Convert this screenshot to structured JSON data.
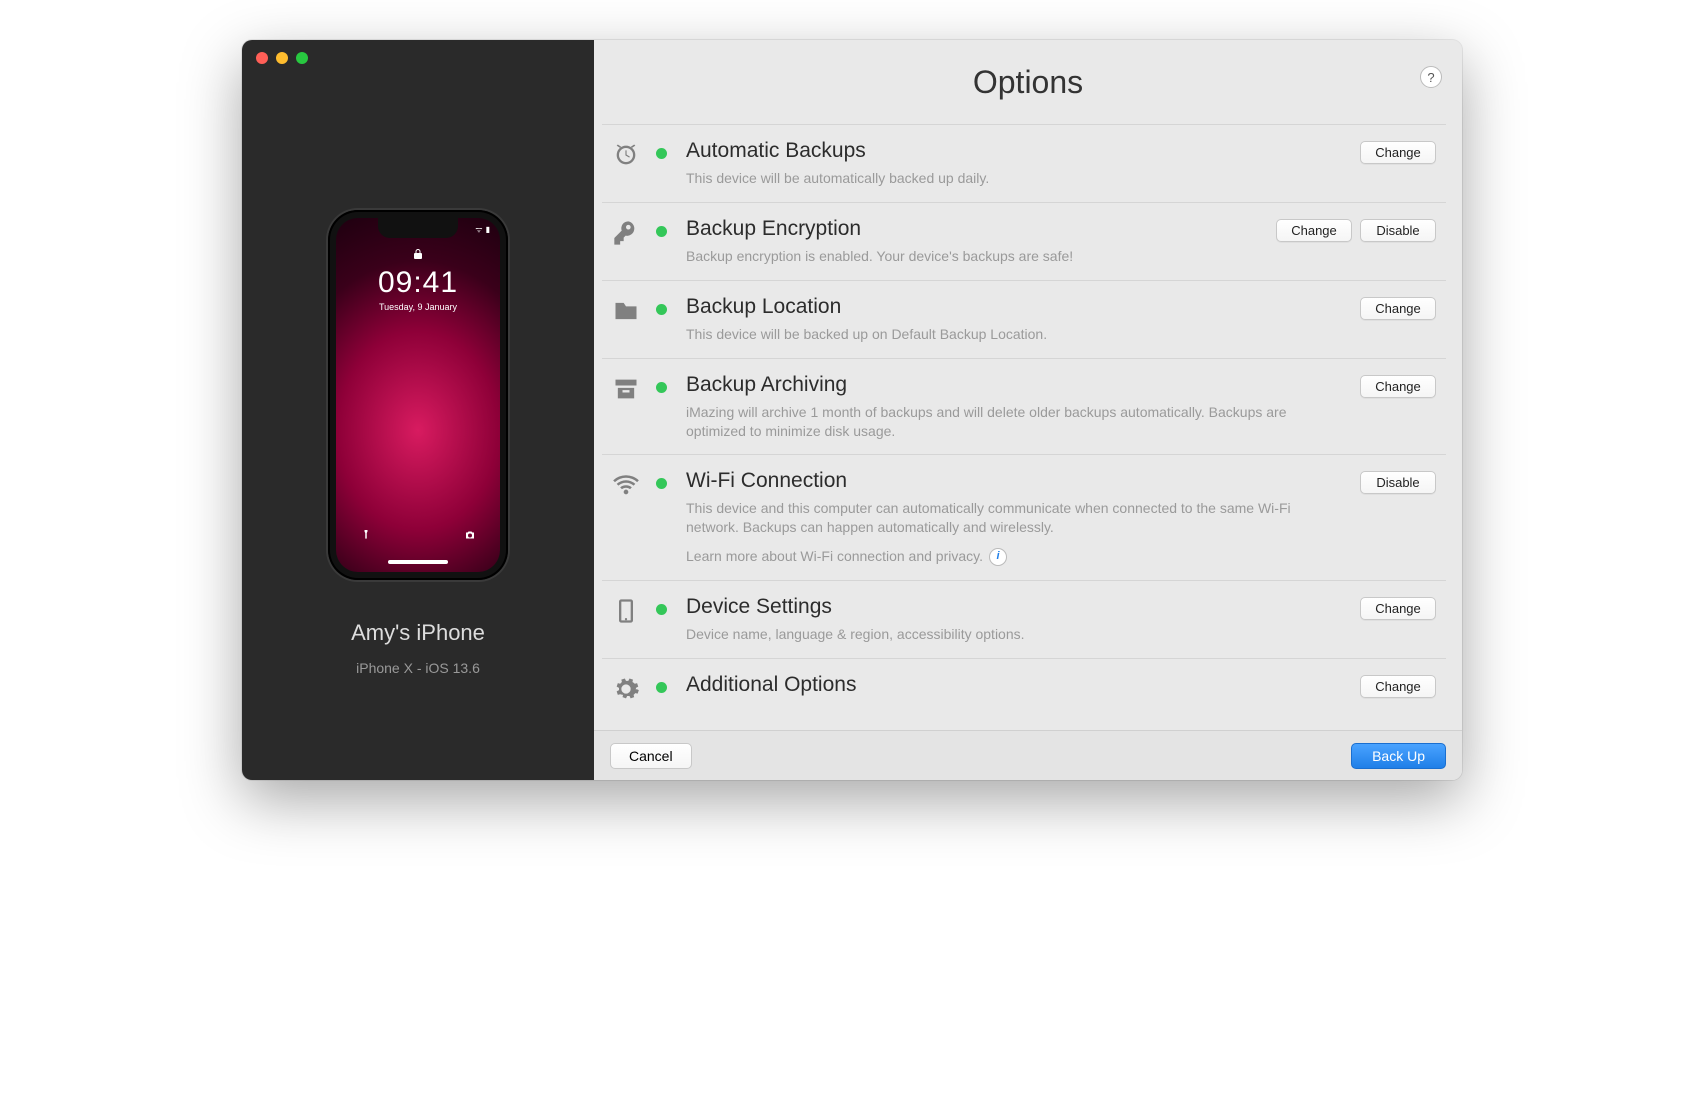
{
  "window": {
    "title": "Options"
  },
  "sidebar": {
    "device_name": "Amy's iPhone",
    "device_model_os": "iPhone X - iOS 13.6",
    "lockscreen_time": "09:41",
    "lockscreen_date": "Tuesday, 9 January"
  },
  "rows": [
    {
      "icon": "alarm-clock-icon",
      "title": "Automatic Backups",
      "desc": "This device will be automatically backed up daily.",
      "status": "on",
      "buttons": [
        "Change"
      ]
    },
    {
      "icon": "key-icon",
      "title": "Backup Encryption",
      "desc": "Backup encryption is enabled. Your device's backups are safe!",
      "status": "on",
      "buttons": [
        "Change",
        "Disable"
      ]
    },
    {
      "icon": "folder-icon",
      "title": "Backup Location",
      "desc": "This device will be backed up on Default Backup Location.",
      "status": "on",
      "buttons": [
        "Change"
      ]
    },
    {
      "icon": "archive-icon",
      "title": "Backup Archiving",
      "desc": "iMazing will archive 1 month of backups and will delete older backups automatically. Backups are optimized to minimize disk usage.",
      "status": "on",
      "buttons": [
        "Change"
      ]
    },
    {
      "icon": "wifi-icon",
      "title": "Wi-Fi Connection",
      "desc": "This device and this computer can automatically communicate when connected to the same Wi-Fi network. Backups can happen automatically and wirelessly.",
      "learn_more": "Learn more about Wi-Fi connection and privacy.",
      "status": "on",
      "buttons": [
        "Disable"
      ]
    },
    {
      "icon": "phone-icon",
      "title": "Device Settings",
      "desc": "Device name, language & region, accessibility options.",
      "status": "on",
      "buttons": [
        "Change"
      ]
    },
    {
      "icon": "gear-icon",
      "title": "Additional Options",
      "desc": "",
      "status": "on",
      "buttons": [
        "Change"
      ]
    }
  ],
  "footer": {
    "cancel": "Cancel",
    "backup": "Back Up"
  },
  "help_label": "?"
}
